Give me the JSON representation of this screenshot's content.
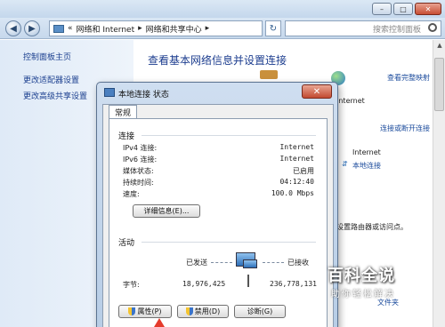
{
  "window": {
    "back_icon": "back-arrow-icon",
    "forward_icon": "forward-arrow-icon",
    "breadcrumb_prefix": "«",
    "breadcrumb_1": "网络和 Internet",
    "breadcrumb_sep": "▸",
    "breadcrumb_2": "网络和共享中心",
    "search_placeholder": "搜索控制面板",
    "minimize": "–",
    "maximize": "□",
    "close": "✕"
  },
  "sidebar": {
    "items": [
      {
        "label": "控制面板主页"
      },
      {
        "label": "更改适配器设置"
      },
      {
        "label": "更改高级共享设置"
      }
    ]
  },
  "main": {
    "title": "查看基本网络信息并设置连接",
    "view_full_map": "查看完整映射",
    "internet_top": "Internet",
    "connect_or_disconnect": "连接或断开连接",
    "internet_label": "Internet",
    "local_connection": "本地连接",
    "router_text": "设置路由器或访问点。",
    "folder_link": "文件夹"
  },
  "dialog": {
    "title": "本地连接 状态",
    "close": "✕",
    "tab": "常规",
    "connection_header": "连接",
    "rows": [
      {
        "label": "IPv4 连接:",
        "value": "Internet"
      },
      {
        "label": "IPv6 连接:",
        "value": "Internet"
      },
      {
        "label": "媒体状态:",
        "value": "已启用"
      },
      {
        "label": "持续时间:",
        "value": "04:12:40"
      },
      {
        "label": "速度:",
        "value": "100.0 Mbps"
      }
    ],
    "details_button": "详细信息(E)...",
    "activity_header": "活动",
    "sent_label": "已发送",
    "received_label": "已接收",
    "bytes_label": "字节:",
    "bytes_sent": "18,976,425",
    "bytes_received": "236,778,131",
    "properties_button": "属性(P)",
    "disable_button": "禁用(D)",
    "diagnose_button": "诊断(G)"
  },
  "watermark": {
    "main": "百科全说",
    "sub": "助你轻松解决"
  }
}
